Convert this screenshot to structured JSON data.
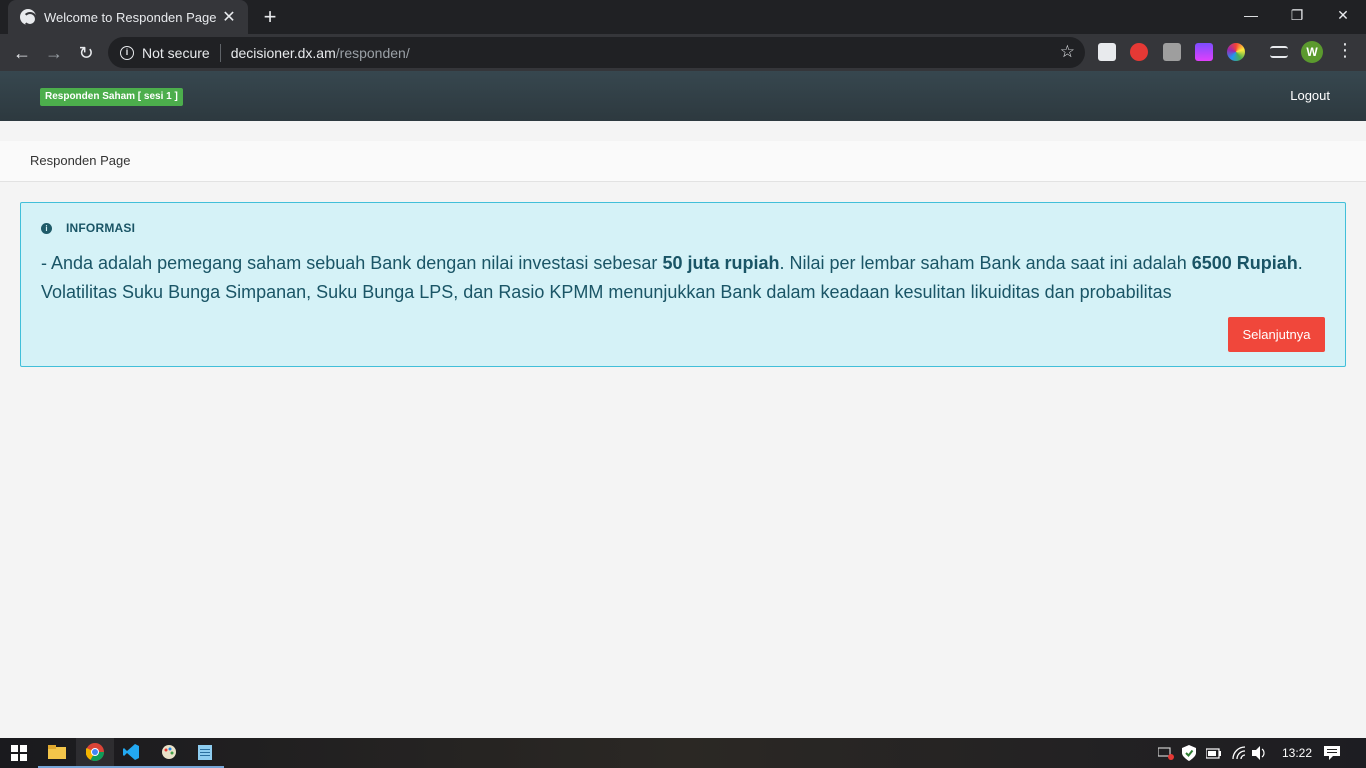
{
  "browser": {
    "tab_title": "Welcome to Responden Page",
    "tab_close": "✕",
    "new_tab": "+",
    "window_controls": {
      "minimize": "—",
      "restore": "❐",
      "close": "✕"
    },
    "nav": {
      "back": "←",
      "forward": "→",
      "reload": "↻"
    },
    "address": {
      "security_label": "Not secure",
      "host": "decisioner.dx.am",
      "path": "/responden/"
    },
    "bookmark_icon": "☆",
    "profile_initial": "W",
    "menu": "⋮"
  },
  "app": {
    "badge": "Responden Saham [ sesi 1 ]",
    "logout": "Logout",
    "breadcrumb": "Responden Page",
    "info": {
      "icon": "i",
      "title": "INFORMASI",
      "text_1": "- Anda adalah pemegang saham sebuah Bank dengan nilai investasi sebesar ",
      "bold_1": "50 juta rupiah",
      "text_2": ". Nilai per lembar saham Bank anda saat ini adalah ",
      "bold_2": "6500 Rupiah",
      "text_3": ". Volatilitas Suku Bunga Simpanan, Suku Bunga LPS, dan Rasio KPMM menunjukkan Bank dalam keadaan kesulitan likuiditas dan probabilitas",
      "next_button": "Selanjutnya"
    }
  },
  "taskbar": {
    "clock": "13:22"
  },
  "colors": {
    "header": "#37474f",
    "badge": "#4cae4c",
    "info_bg": "#d5f2f7",
    "info_border": "#41bfd9",
    "info_text": "#1a5566",
    "button": "#f0473b"
  }
}
